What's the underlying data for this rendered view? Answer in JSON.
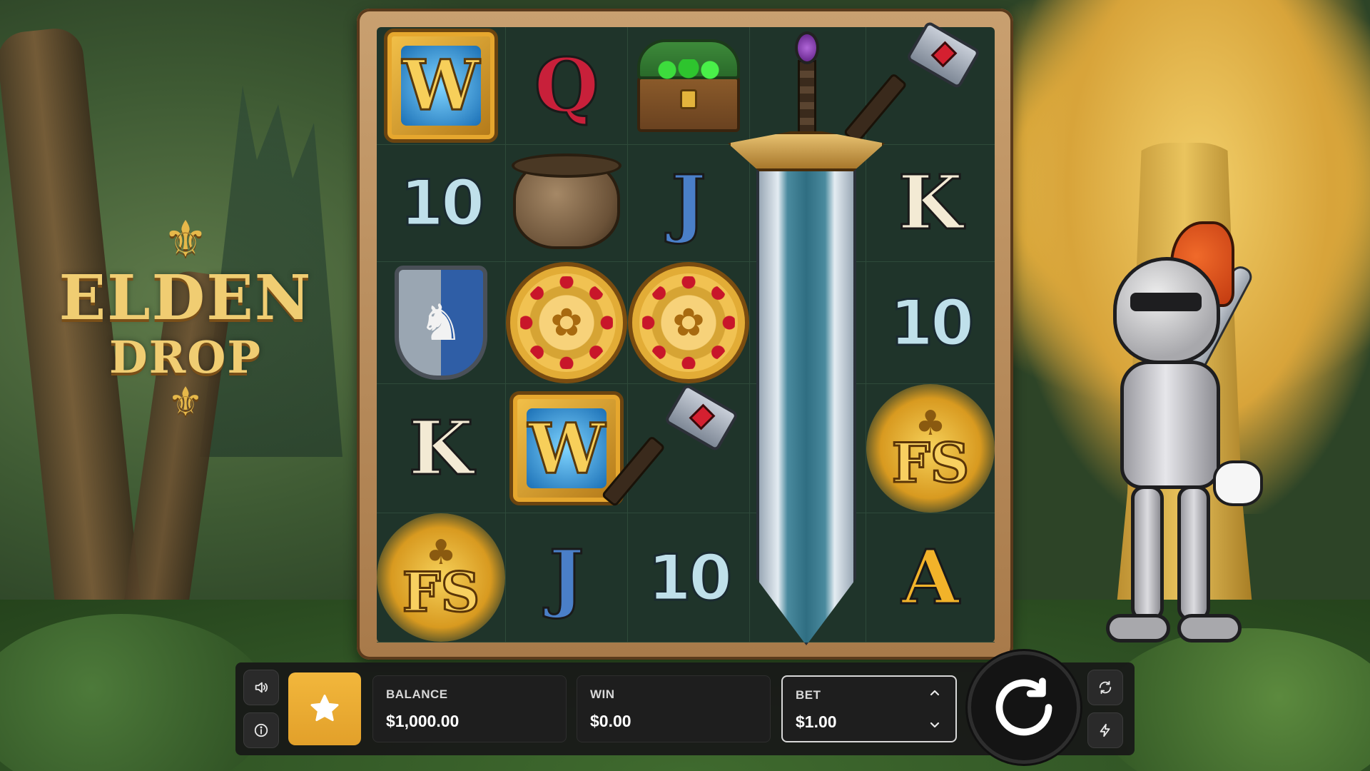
{
  "game": {
    "logo_line1": "ELDEN",
    "logo_line2": "DROP"
  },
  "reels": {
    "rows": [
      [
        "wild-W",
        "Q",
        "treasure-chest",
        "sword",
        "war-hammer"
      ],
      [
        "10",
        "cauldron",
        "J",
        "sword",
        "K"
      ],
      [
        "lion-shield",
        "gold-coin",
        "gold-coin",
        "sword",
        "10"
      ],
      [
        "K",
        "wild-W",
        "war-hammer",
        "sword",
        "free-spins-FS"
      ],
      [
        "free-spins-FS",
        "J",
        "10",
        "sword",
        "A"
      ]
    ],
    "glyphs": {
      "wild": "W",
      "q": "Q",
      "j": "J",
      "k": "K",
      "a": "A",
      "ten": "10",
      "fs": "FS"
    }
  },
  "controls": {
    "balance_label": "BALANCE",
    "balance_value": "$1,000.00",
    "win_label": "WIN",
    "win_value": "$0.00",
    "bet_label": "BET",
    "bet_value": "$1.00"
  },
  "icons": {
    "sound": "speaker-icon",
    "info": "info-icon",
    "favorite": "star-icon",
    "spin": "spin-arrow-icon",
    "autoplay": "autoplay-icon",
    "turbo": "lightning-icon",
    "bet_up": "chevron-up-icon",
    "bet_down": "chevron-down-icon"
  },
  "colors": {
    "accent": "#f2b73c",
    "bar_bg": "#181818",
    "reel_bg": "#1f342a"
  }
}
